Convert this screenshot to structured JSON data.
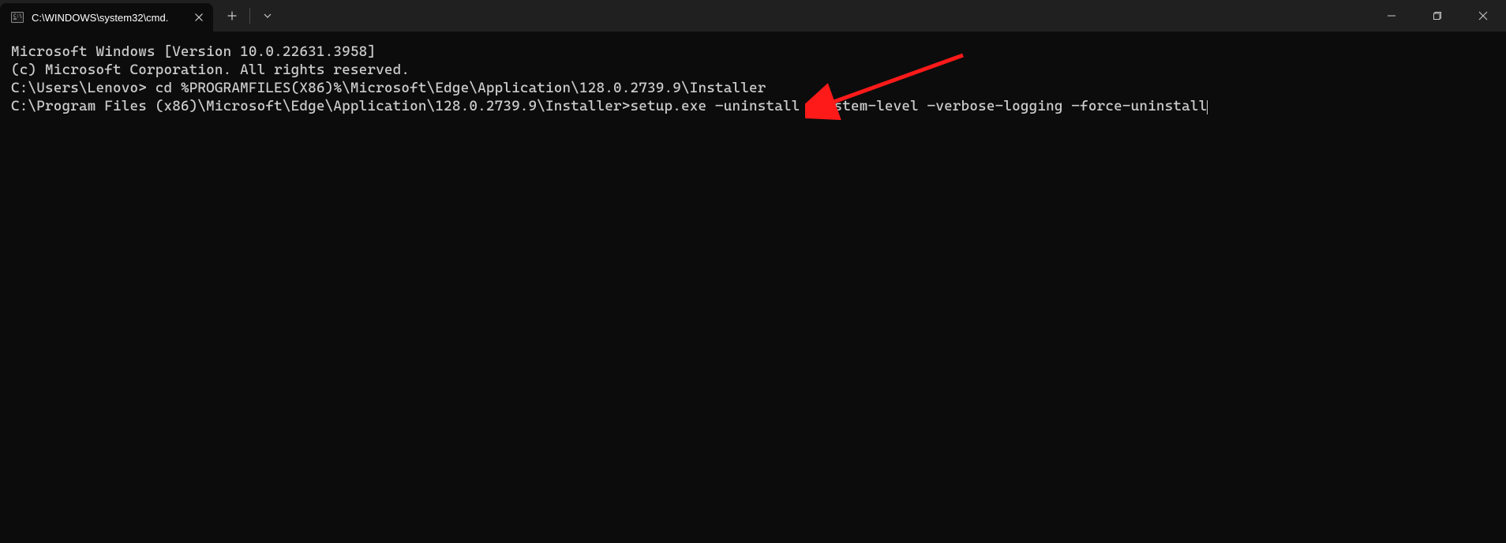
{
  "titlebar": {
    "tab": {
      "title": "C:\\WINDOWS\\system32\\cmd."
    }
  },
  "terminal": {
    "line1": "Microsoft Windows [Version 10.0.22631.3958]",
    "line2": "(c) Microsoft Corporation. All rights reserved.",
    "blank1": "",
    "prompt1": "C:\\Users\\Lenovo> ",
    "command1": "cd %PROGRAMFILES(X86)%\\Microsoft\\Edge\\Application\\128.0.2739.9\\Installer",
    "blank2": "",
    "prompt2": "C:\\Program Files (x86)\\Microsoft\\Edge\\Application\\128.0.2739.9\\Installer>",
    "command2": "setup.exe –uninstall –system-level –verbose-logging –force-uninstall"
  }
}
